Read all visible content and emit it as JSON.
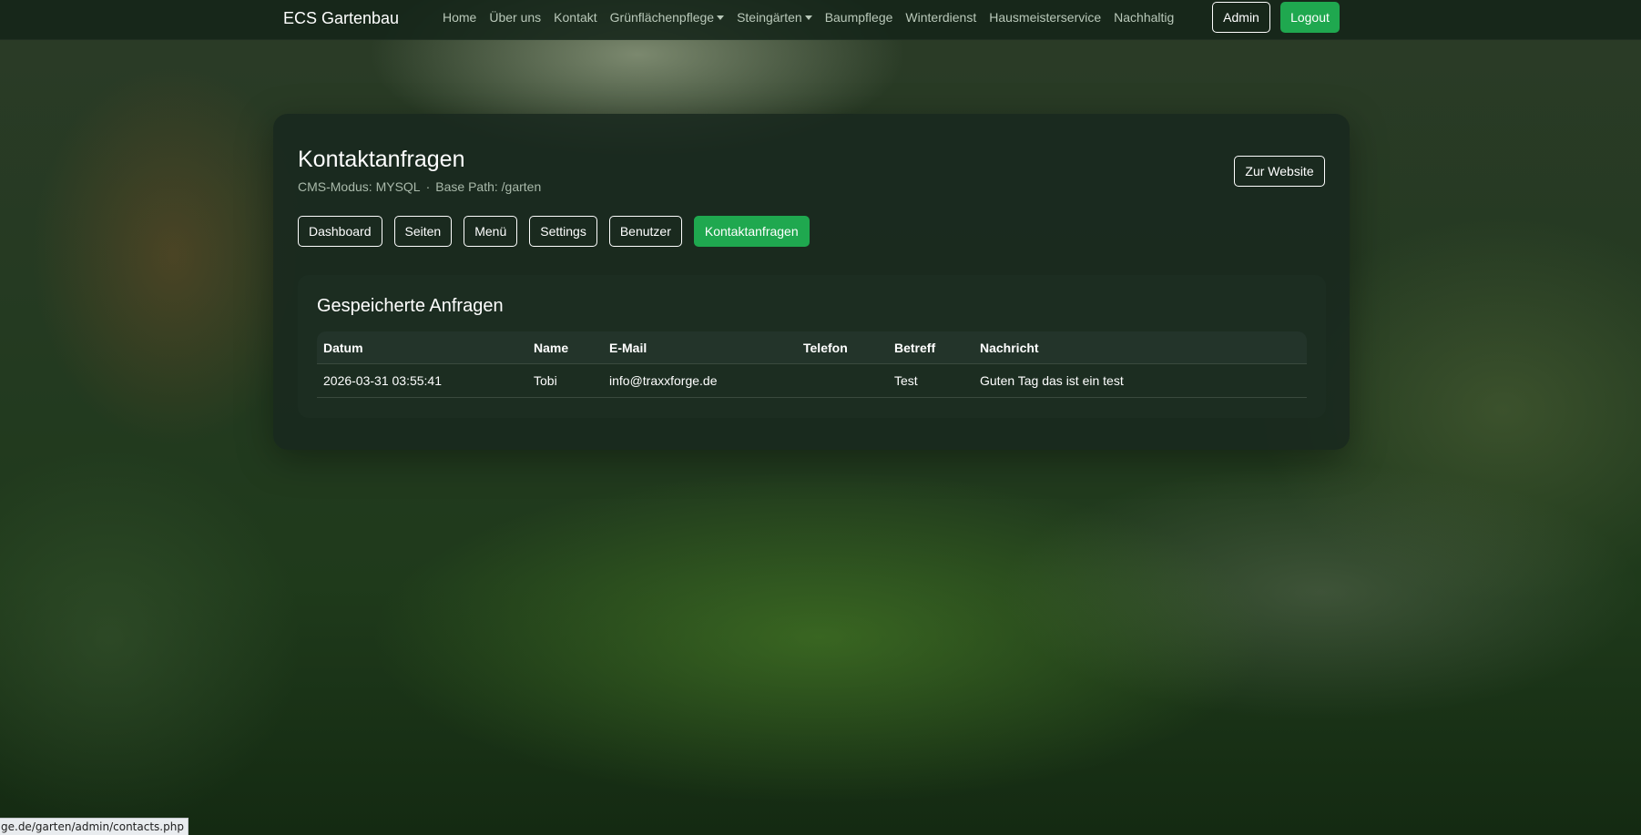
{
  "navbar": {
    "brand": "ECS Gartenbau",
    "links": [
      {
        "label": "Home",
        "dropdown": false
      },
      {
        "label": "Über uns",
        "dropdown": false
      },
      {
        "label": "Kontakt",
        "dropdown": false
      },
      {
        "label": "Grünflächenpflege",
        "dropdown": true
      },
      {
        "label": "Steingärten",
        "dropdown": true
      },
      {
        "label": "Baumpflege",
        "dropdown": false
      },
      {
        "label": "Winterdienst",
        "dropdown": false
      },
      {
        "label": "Hausmeisterservice",
        "dropdown": false
      },
      {
        "label": "Nachhaltig",
        "dropdown": false
      }
    ],
    "admin_label": "Admin",
    "logout_label": "Logout"
  },
  "header": {
    "title": "Kontaktanfragen",
    "cms_mode": "CMS-Modus: MYSQL",
    "separator": "·",
    "base_path": "Base Path: /garten",
    "website_label": "Zur Website"
  },
  "tabs": [
    {
      "label": "Dashboard",
      "active": false
    },
    {
      "label": "Seiten",
      "active": false
    },
    {
      "label": "Menü",
      "active": false
    },
    {
      "label": "Settings",
      "active": false
    },
    {
      "label": "Benutzer",
      "active": false
    },
    {
      "label": "Kontaktanfragen",
      "active": true
    }
  ],
  "contacts": {
    "title": "Gespeicherte Anfragen",
    "columns": [
      "Datum",
      "Name",
      "E-Mail",
      "Telefon",
      "Betreff",
      "Nachricht"
    ],
    "rows": [
      [
        "2026-03-31 03:55:41",
        "Tobi",
        "info@traxxforge.de",
        "",
        "Test",
        "Guten Tag das ist ein test"
      ]
    ]
  },
  "status_url": "ge.de/garten/admin/contacts.php",
  "colors": {
    "accent": "#1fa84f",
    "navbar_bg": "#142418",
    "card_bg": "#18281e"
  }
}
